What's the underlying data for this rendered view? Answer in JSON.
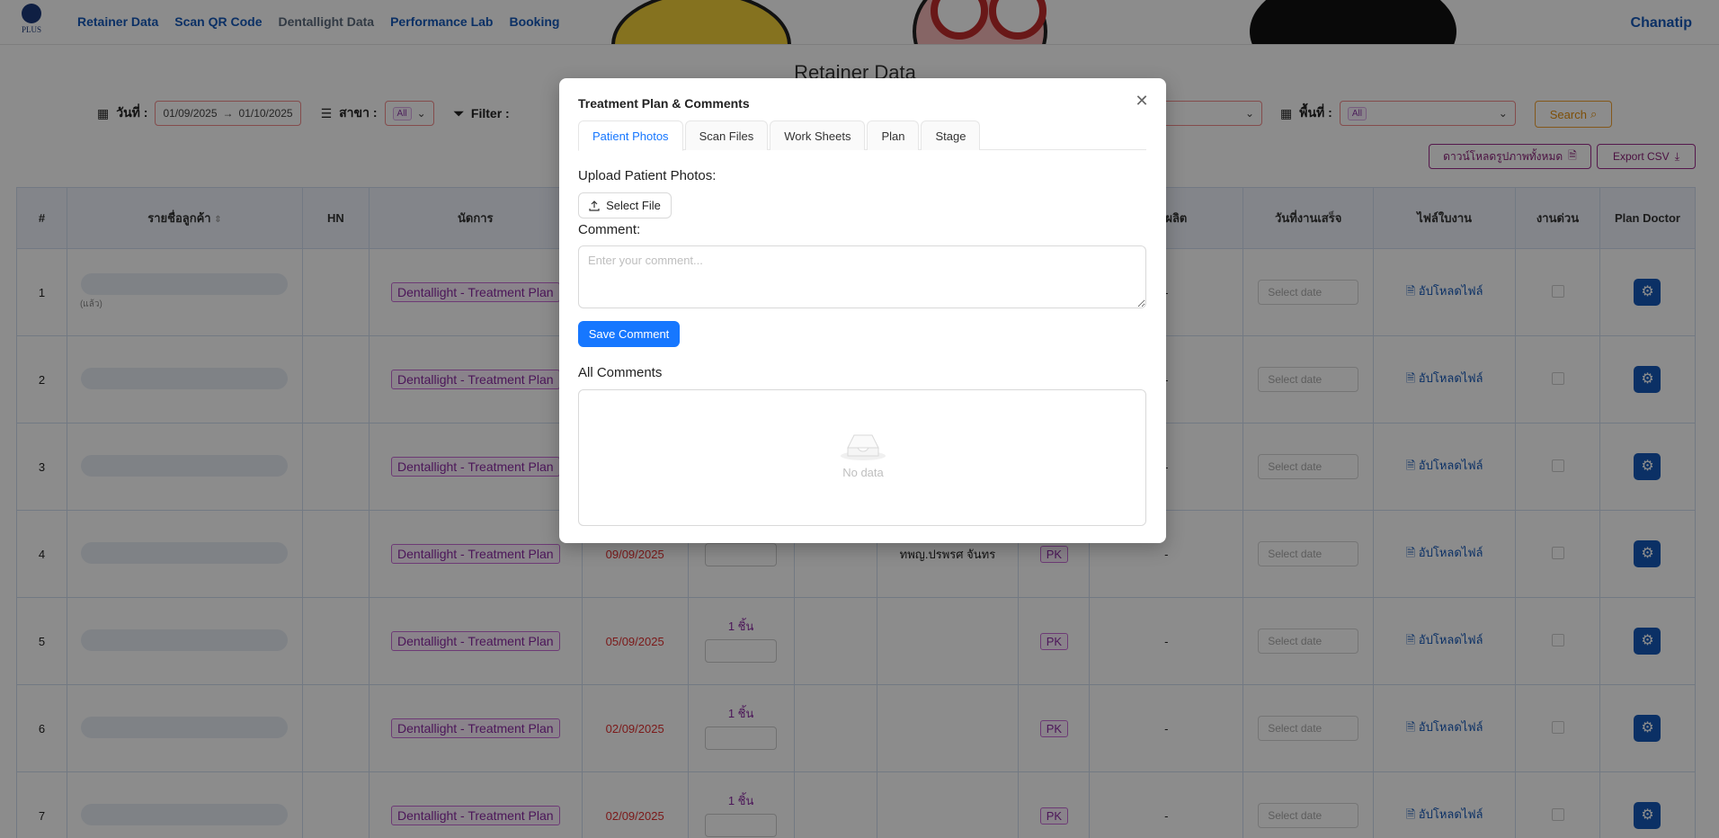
{
  "app": {
    "logo_text": "PLUS",
    "nav": [
      "Retainer Data",
      "Scan QR Code",
      "Dentallight Data",
      "Performance Lab",
      "Booking"
    ],
    "user": "Chanatip"
  },
  "page": {
    "title": "Retainer Data",
    "filters": {
      "date_label": "วันที่ :",
      "date_from": "01/09/2025",
      "date_sep": "→",
      "date_to": "01/10/2025",
      "branch_label": "สาขา :",
      "branch_value": "All",
      "filter_label": "Filter :",
      "area_label": "พื้นที่ :",
      "area_value": "All",
      "search_label": "Search"
    },
    "download_all_label": "ดาวน์โหลดรูปภาพทั้งหมด",
    "export_csv_label": "Export CSV"
  },
  "table": {
    "headers": [
      "#",
      "รายชื่อลูกค้า",
      "HN",
      "นัดการ",
      "",
      "",
      "",
      "",
      "",
      "การผลิต",
      "วันที่งานเสร็จ",
      "ไฟล์ใบงาน",
      "งานด่วน",
      "Plan Doctor"
    ],
    "rows": [
      {
        "num": "1",
        "name_hint": "(แล้ว)",
        "appt": "Dentallight - Treatment Plan",
        "date": "",
        "qty": "",
        "doctor": "",
        "status": "",
        "prod": "-",
        "done_ph": "Select date",
        "file": "อัปโหลดไฟล์"
      },
      {
        "num": "2",
        "name_hint": "",
        "appt": "Dentallight - Treatment Plan",
        "date": "",
        "qty": "",
        "doctor": "",
        "status": "",
        "prod": "-",
        "done_ph": "Select date",
        "file": "อัปโหลดไฟล์"
      },
      {
        "num": "3",
        "name_hint": "",
        "appt": "Dentallight - Treatment Plan",
        "date": "",
        "qty": "",
        "doctor": "",
        "status": "",
        "prod": "-",
        "done_ph": "Select date",
        "file": "อัปโหลดไฟล์"
      },
      {
        "num": "4",
        "name_hint": "",
        "appt": "Dentallight - Treatment Plan",
        "date": "09/09/2025",
        "qty": "",
        "doctor": "ทพญ.ปรพรศ จันทร",
        "status": "PK",
        "prod": "-",
        "done_ph": "Select date",
        "file": "อัปโหลดไฟล์"
      },
      {
        "num": "5",
        "name_hint": "",
        "appt": "Dentallight - Treatment Plan",
        "date": "05/09/2025",
        "qty": "1 ชิ้น",
        "doctor": "",
        "status": "PK",
        "prod": "-",
        "done_ph": "Select date",
        "file": "อัปโหลดไฟล์"
      },
      {
        "num": "6",
        "name_hint": "",
        "appt": "Dentallight - Treatment Plan",
        "date": "02/09/2025",
        "qty": "1 ชิ้น",
        "doctor": "",
        "status": "PK",
        "prod": "-",
        "done_ph": "Select date",
        "file": "อัปโหลดไฟล์"
      },
      {
        "num": "7",
        "name_hint": "",
        "appt": "Dentallight - Treatment Plan",
        "date": "02/09/2025",
        "qty": "1 ชิ้น",
        "doctor": "",
        "status": "PK",
        "prod": "-",
        "done_ph": "Select date",
        "file": "อัปโหลดไฟล์"
      }
    ]
  },
  "modal": {
    "title": "Treatment Plan & Comments",
    "tabs": [
      "Patient Photos",
      "Scan Files",
      "Work Sheets",
      "Plan",
      "Stage"
    ],
    "active_tab": "Patient Photos",
    "upload_label": "Upload Patient Photos:",
    "select_file_label": "Select File",
    "comment_label": "Comment:",
    "comment_placeholder": "Enter your comment...",
    "comment_value": "",
    "save_label": "Save Comment",
    "all_comments_label": "All Comments",
    "empty_text": "No data"
  },
  "colors": {
    "primary": "#1677ff",
    "nav_link": "#1558b8",
    "tag_purple": "#8b2aa3",
    "date_red": "#e03030",
    "search_orange": "#e59010"
  },
  "icons": [
    "close-icon",
    "upload-icon",
    "empty-inbox-icon",
    "calendar-icon",
    "list-icon",
    "filter-icon",
    "grid-icon",
    "search-icon",
    "download-icon",
    "file-icon",
    "gear-icon",
    "sort-icon",
    "chevron-down-icon"
  ]
}
